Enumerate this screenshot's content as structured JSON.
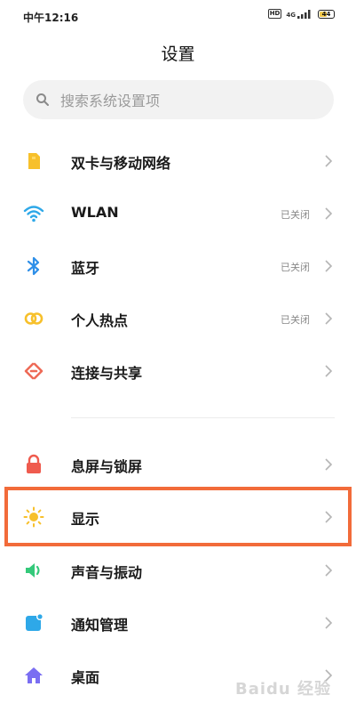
{
  "status_bar": {
    "time": "中午12:16",
    "hd": "HD",
    "net": "4G",
    "battery": "44"
  },
  "header": {
    "title": "设置"
  },
  "search": {
    "placeholder": "搜索系统设置项"
  },
  "items": [
    {
      "label": "双卡与移动网络",
      "status": "",
      "icon": "sim-card-icon",
      "color": "#f7c02b"
    },
    {
      "label": "WLAN",
      "status": "已关闭",
      "icon": "wifi-icon",
      "color": "#2ea8e8"
    },
    {
      "label": "蓝牙",
      "status": "已关闭",
      "icon": "bluetooth-icon",
      "color": "#2e8fe8"
    },
    {
      "label": "个人热点",
      "status": "已关闭",
      "icon": "hotspot-icon",
      "color": "#f7c02b"
    },
    {
      "label": "连接与共享",
      "status": "",
      "icon": "connection-share-icon",
      "color": "#ee6a57"
    },
    {
      "label": "息屏与锁屏",
      "status": "",
      "icon": "lock-icon",
      "color": "#ef5b4e"
    },
    {
      "label": "显示",
      "status": "",
      "icon": "sun-icon",
      "color": "#f7c02b"
    },
    {
      "label": "声音与振动",
      "status": "",
      "icon": "speaker-icon",
      "color": "#34c97a"
    },
    {
      "label": "通知管理",
      "status": "",
      "icon": "notification-icon",
      "color": "#2ea8e8"
    },
    {
      "label": "桌面",
      "status": "",
      "icon": "home-icon",
      "color": "#7a6ef2"
    }
  ],
  "highlight_color": "#f26b3a",
  "watermark": "Baidu 经验"
}
